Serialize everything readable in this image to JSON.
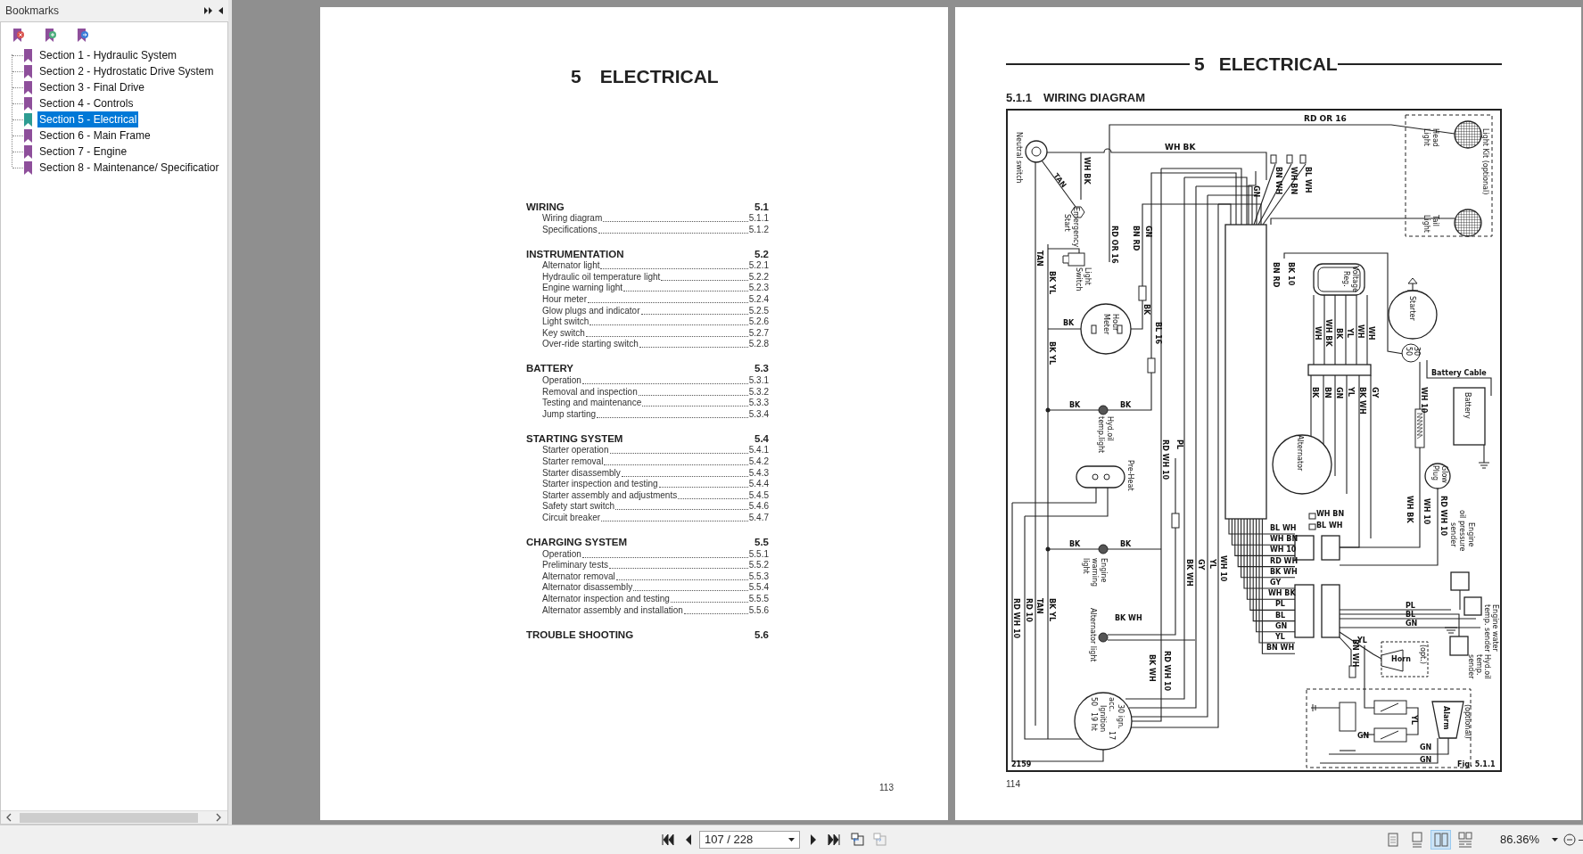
{
  "sidebar": {
    "title": "Bookmarks",
    "items": [
      {
        "label": "Section 1 - Hydraulic System",
        "selected": false
      },
      {
        "label": "Section 2 - Hydrostatic Drive System",
        "selected": false
      },
      {
        "label": "Section 3 - Final Drive",
        "selected": false
      },
      {
        "label": "Section 4 - Controls",
        "selected": false
      },
      {
        "label": "Section 5 - Electrical",
        "selected": true
      },
      {
        "label": "Section 6 - Main Frame",
        "selected": false
      },
      {
        "label": "Section 7 - Engine",
        "selected": false
      },
      {
        "label": "Section 8 - Maintenance/ Specificatior",
        "selected": false
      }
    ]
  },
  "page_left": {
    "chapter_number": "5",
    "chapter_title": "ELECTRICAL",
    "contents": [
      {
        "title": "WIRING",
        "number": "5.1",
        "entries": [
          {
            "title": "Wiring diagram",
            "number": "5.1.1"
          },
          {
            "title": "Specifications",
            "number": "5.1.2"
          }
        ]
      },
      {
        "title": "INSTRUMENTATION",
        "number": "5.2",
        "entries": [
          {
            "title": "Alternator light",
            "number": "5.2.1"
          },
          {
            "title": "Hydraulic oil temperature light",
            "number": "5.2.2"
          },
          {
            "title": "Engine warning light",
            "number": "5.2.3"
          },
          {
            "title": "Hour meter",
            "number": "5.2.4"
          },
          {
            "title": "Glow plugs and indicator",
            "number": "5.2.5"
          },
          {
            "title": "Light switch",
            "number": "5.2.6"
          },
          {
            "title": "Key switch",
            "number": "5.2.7"
          },
          {
            "title": "Over-ride starting switch",
            "number": "5.2.8"
          }
        ]
      },
      {
        "title": "BATTERY",
        "number": "5.3",
        "entries": [
          {
            "title": "Operation",
            "number": "5.3.1"
          },
          {
            "title": "Removal and inspection",
            "number": "5.3.2"
          },
          {
            "title": "Testing and maintenance",
            "number": "5.3.3"
          },
          {
            "title": "Jump starting",
            "number": "5.3.4"
          }
        ]
      },
      {
        "title": "STARTING SYSTEM",
        "number": "5.4",
        "entries": [
          {
            "title": "Starter operation",
            "number": "5.4.1"
          },
          {
            "title": "Starter removal",
            "number": "5.4.2"
          },
          {
            "title": "Starter disassembly",
            "number": "5.4.3"
          },
          {
            "title": "Starter inspection and testing",
            "number": "5.4.4"
          },
          {
            "title": "Starter assembly and adjustments",
            "number": "5.4.5"
          },
          {
            "title": "Safety start switch",
            "number": "5.4.6"
          },
          {
            "title": "Circuit breaker",
            "number": "5.4.7"
          }
        ]
      },
      {
        "title": "CHARGING SYSTEM",
        "number": "5.5",
        "entries": [
          {
            "title": "Operation",
            "number": "5.5.1"
          },
          {
            "title": "Preliminary tests",
            "number": "5.5.2"
          },
          {
            "title": "Alternator removal",
            "number": "5.5.3"
          },
          {
            "title": "Alternator disassembly",
            "number": "5.5.4"
          },
          {
            "title": "Alternator inspection and testing",
            "number": "5.5.5"
          },
          {
            "title": "Alternator assembly and installation",
            "number": "5.5.6"
          }
        ]
      },
      {
        "title": "TROUBLE SHOOTING",
        "number": "5.6"
      }
    ],
    "page_number": "113"
  },
  "page_right": {
    "chapter_number": "5",
    "chapter_title": "ELECTRICAL",
    "section_number": "5.1.1",
    "section_title": "WIRING DIAGRAM",
    "diagram_labels": [
      "RD OR 16",
      "WH BK",
      "Neutral switch",
      "TAN",
      "WH BK",
      "Emergency",
      "Start",
      "RD OR 16",
      "BN RD",
      "GN",
      "GN",
      "BN WH",
      "WH BN",
      "BL WH",
      "Head",
      "Light",
      "Light Kit (optional)",
      "Tail",
      "Light",
      "TAN",
      "BK YL",
      "Light",
      "Switch",
      "BN RD",
      "BK 10",
      "Voltage",
      "Reg.",
      "Starter",
      "BK",
      "Hour",
      "Meter",
      "BK",
      "BL 16",
      "BK YL",
      "WH",
      "WH BK",
      "BK",
      "YL",
      "WH",
      "WH",
      "30",
      "50",
      "Battery Cable",
      "WH 10",
      "BK",
      "BK",
      "Hyd.oil",
      "temp.light",
      "Battery",
      "BK",
      "BN",
      "GN",
      "YL",
      "BK WH",
      "GY",
      "PL",
      "RD WH 10",
      "Alternator",
      "Pre-Heat",
      "Glow",
      "Plug",
      "WH BK",
      "WH 10",
      "RD WH 10",
      "WH BN",
      "BL WH",
      "BL WH",
      "WH BN",
      "WH 10",
      "RD WH",
      "BK WH",
      "GY",
      "WH BK",
      "PL",
      "BL",
      "GN",
      "YL",
      "BN WH",
      "BK",
      "BK",
      "Engine",
      "warning",
      "light",
      "BK WH",
      "GY",
      "YL",
      "WH 10",
      "Engine",
      "oil pressure",
      "sender",
      "PL",
      "BL",
      "GN",
      "Engine water",
      "temp. sender",
      "YL",
      "Horn",
      "(opt.)",
      "Hyd.oil",
      "temp.",
      "sender",
      "BN WH",
      "BK WH",
      "Alternator light",
      "RD WH 10",
      "RD 10",
      "TAN",
      "BK YL",
      "BK WH",
      "RD WH 10",
      "Ignition",
      "acc.",
      "30 ign.",
      "17",
      "50",
      "19 ht",
      "2159",
      "Alarm",
      "(optional)",
      "YL",
      "GN",
      "GN",
      "GN",
      "Fig. 5.1.1"
    ],
    "page_number": "114"
  },
  "toolbar": {
    "page_field": "107 / 228",
    "view_modes": [
      {
        "selected": false
      },
      {
        "selected": false
      },
      {
        "selected": true
      },
      {
        "selected": false
      }
    ],
    "zoom": "86.36%"
  }
}
